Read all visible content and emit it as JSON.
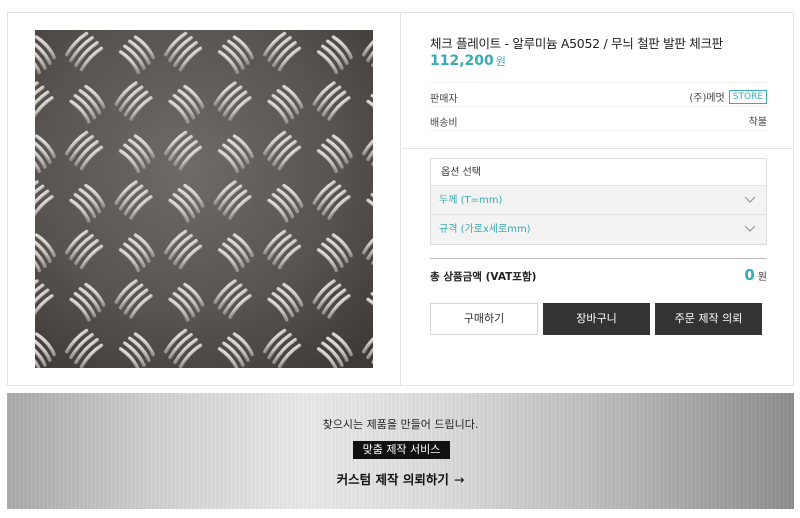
{
  "product": {
    "title": "체크 플레이트 - 알루미늄 A5052 / 무늬 철판 발판 체크판",
    "price": "112,200",
    "price_unit": "원",
    "seller_label": "판매자",
    "seller_name": "(주)메멋",
    "store_badge": "STORE",
    "shipping_label": "배송비",
    "shipping_value": "착불"
  },
  "options": {
    "header": "옵션 선택",
    "selects": [
      {
        "placeholder": "두께 (T=mm)"
      },
      {
        "placeholder": "규격 (가로x세로mm)"
      }
    ]
  },
  "total": {
    "label": "총 상품금액 (VAT포함)",
    "value": "0",
    "unit": "원"
  },
  "buttons": {
    "buy": "구매하기",
    "cart": "장바구니",
    "order": "주문 제작 의뢰"
  },
  "banner": {
    "subtitle": "찾으시는 제품을 만들어 드립니다.",
    "tag": "맞춤 제작 서비스",
    "link": "커스텀 제작 의뢰하기",
    "link_arrow": "→"
  },
  "colors": {
    "accent": "#39aab3",
    "dark_button": "#333333"
  },
  "icons": {
    "select_chevron": "chevron-down-icon",
    "link_arrow": "arrow-right-icon"
  }
}
